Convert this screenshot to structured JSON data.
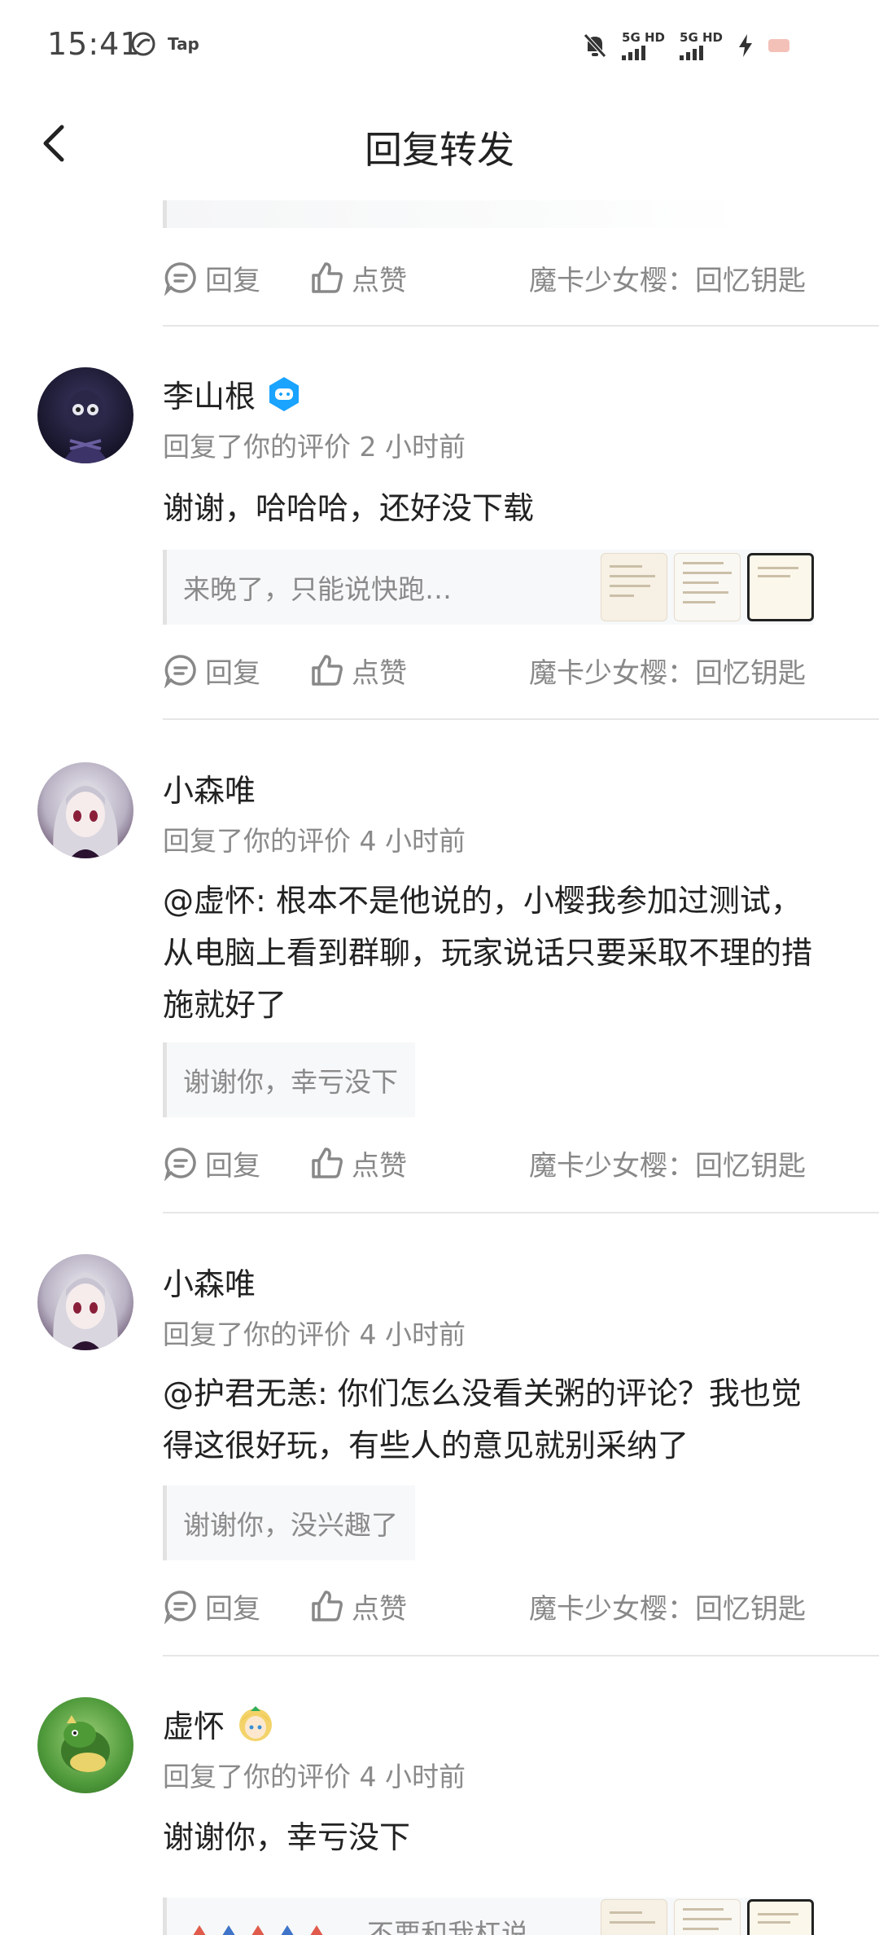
{
  "status": {
    "time": "15:41",
    "tap_label": "Tap",
    "net1": "5G HD",
    "net2": "5G HD"
  },
  "header": {
    "title": "回复转发"
  },
  "actions": {
    "reply": "回复",
    "like": "点赞",
    "game": "魔卡少女樱：回忆钥匙"
  },
  "entries": [
    {
      "user": "李山根",
      "meta": "回复了你的评价 2 小时前",
      "text": "谢谢，哈哈哈，还好没下载",
      "quote": "来晚了，只能说快跑…"
    },
    {
      "user": "小森唯",
      "meta": "回复了你的评价 4 小时前",
      "text": "@虚怀: 根本不是他说的，小樱我参加过测试，从电脑上看到群聊，玩家说话只要采取不理的措施就好了",
      "quote": "谢谢你，幸亏没下"
    },
    {
      "user": "小森唯",
      "meta": "回复了你的评价 4 小时前",
      "text": "@护君无恙: 你们怎么没看关粥的评论？我也觉得这很好玩，有些人的意见就别采纳了",
      "quote": "谢谢你，没兴趣了"
    },
    {
      "user": "虚怀",
      "meta": "回复了你的评价 4 小时前",
      "text": "谢谢你，幸亏没下",
      "quote": "不要和我杠说…"
    }
  ],
  "colors": {
    "accent_badge": "#1aa3ff",
    "muted": "#8a8a8a",
    "divider": "#e6e6e6"
  }
}
